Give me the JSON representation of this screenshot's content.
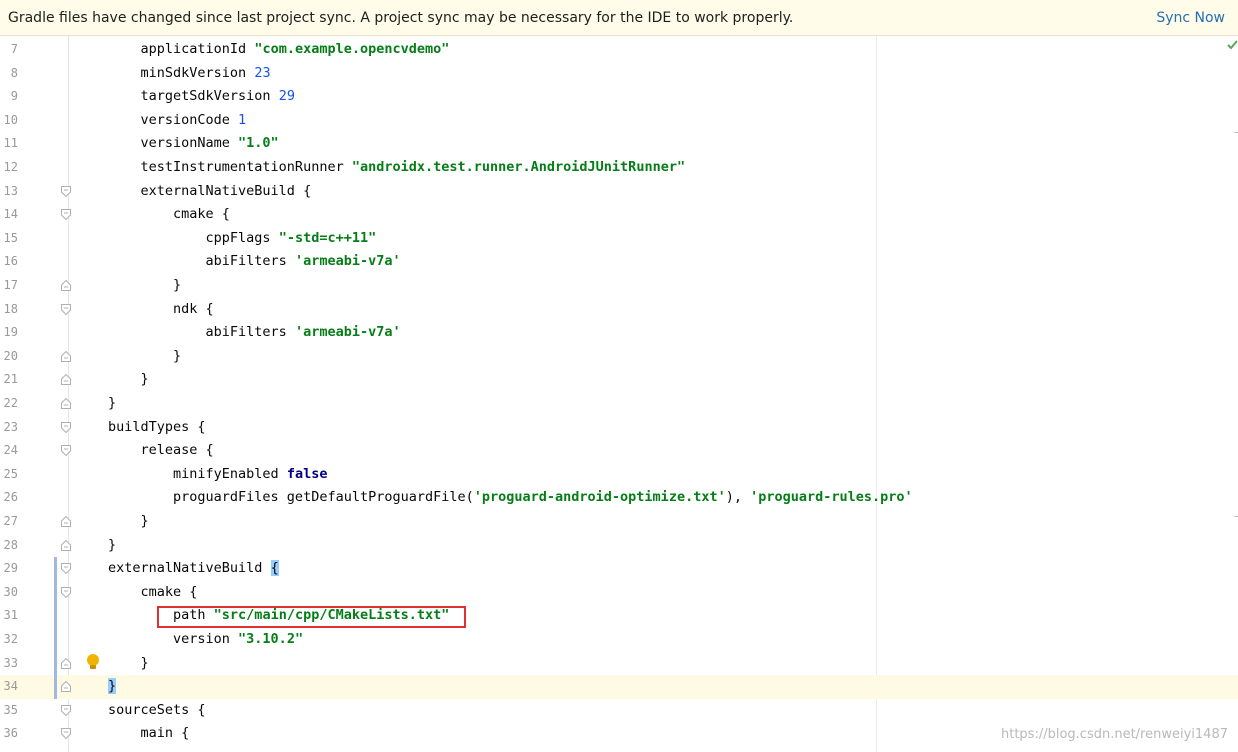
{
  "banner": {
    "message": "Gradle files have changed since last project sync. A project sync may be necessary for the IDE to work properly.",
    "action": "Sync Now"
  },
  "editor": {
    "lines": [
      {
        "n": "7",
        "code": "    applicationId \"com.example.opencvdemo\""
      },
      {
        "n": "8",
        "code": "    minSdkVersion 23"
      },
      {
        "n": "9",
        "code": "    targetSdkVersion 29"
      },
      {
        "n": "10",
        "code": "    versionCode 1"
      },
      {
        "n": "11",
        "code": "    versionName \"1.0\""
      },
      {
        "n": "12",
        "code": "    testInstrumentationRunner \"androidx.test.runner.AndroidJUnitRunner\""
      },
      {
        "n": "13",
        "code": "    externalNativeBuild {"
      },
      {
        "n": "14",
        "code": "        cmake {"
      },
      {
        "n": "15",
        "code": "            cppFlags \"-std=c++11\""
      },
      {
        "n": "16",
        "code": "            abiFilters 'armeabi-v7a'"
      },
      {
        "n": "17",
        "code": "        }"
      },
      {
        "n": "18",
        "code": "        ndk {"
      },
      {
        "n": "19",
        "code": "            abiFilters 'armeabi-v7a'"
      },
      {
        "n": "20",
        "code": "        }"
      },
      {
        "n": "21",
        "code": "    }"
      },
      {
        "n": "22",
        "code": "}"
      },
      {
        "n": "23",
        "code": "buildTypes {"
      },
      {
        "n": "24",
        "code": "    release {"
      },
      {
        "n": "25",
        "code": "        minifyEnabled false"
      },
      {
        "n": "26",
        "code": "        proguardFiles getDefaultProguardFile('proguard-android-optimize.txt'), 'proguard-rules.pro'"
      },
      {
        "n": "27",
        "code": "    }"
      },
      {
        "n": "28",
        "code": "}"
      },
      {
        "n": "29",
        "code": "externalNativeBuild {"
      },
      {
        "n": "30",
        "code": "    cmake {"
      },
      {
        "n": "31",
        "code": "        path \"src/main/cpp/CMakeLists.txt\""
      },
      {
        "n": "32",
        "code": "        version \"3.10.2\""
      },
      {
        "n": "33",
        "code": "    }"
      },
      {
        "n": "34",
        "code": "}"
      },
      {
        "n": "35",
        "code": "sourceSets {"
      },
      {
        "n": "36",
        "code": "    main {"
      }
    ],
    "current_line": "34",
    "highlighted_line": "31"
  },
  "watermark": "https://blog.csdn.net/renweiyi1487",
  "colors": {
    "banner_bg": "#fffce9",
    "link": "#2470b3",
    "string": "#067d17",
    "number": "#1750eb",
    "keyword": "#000080",
    "annotation_box": "#e03030",
    "current_line_bg": "#fffae3"
  }
}
